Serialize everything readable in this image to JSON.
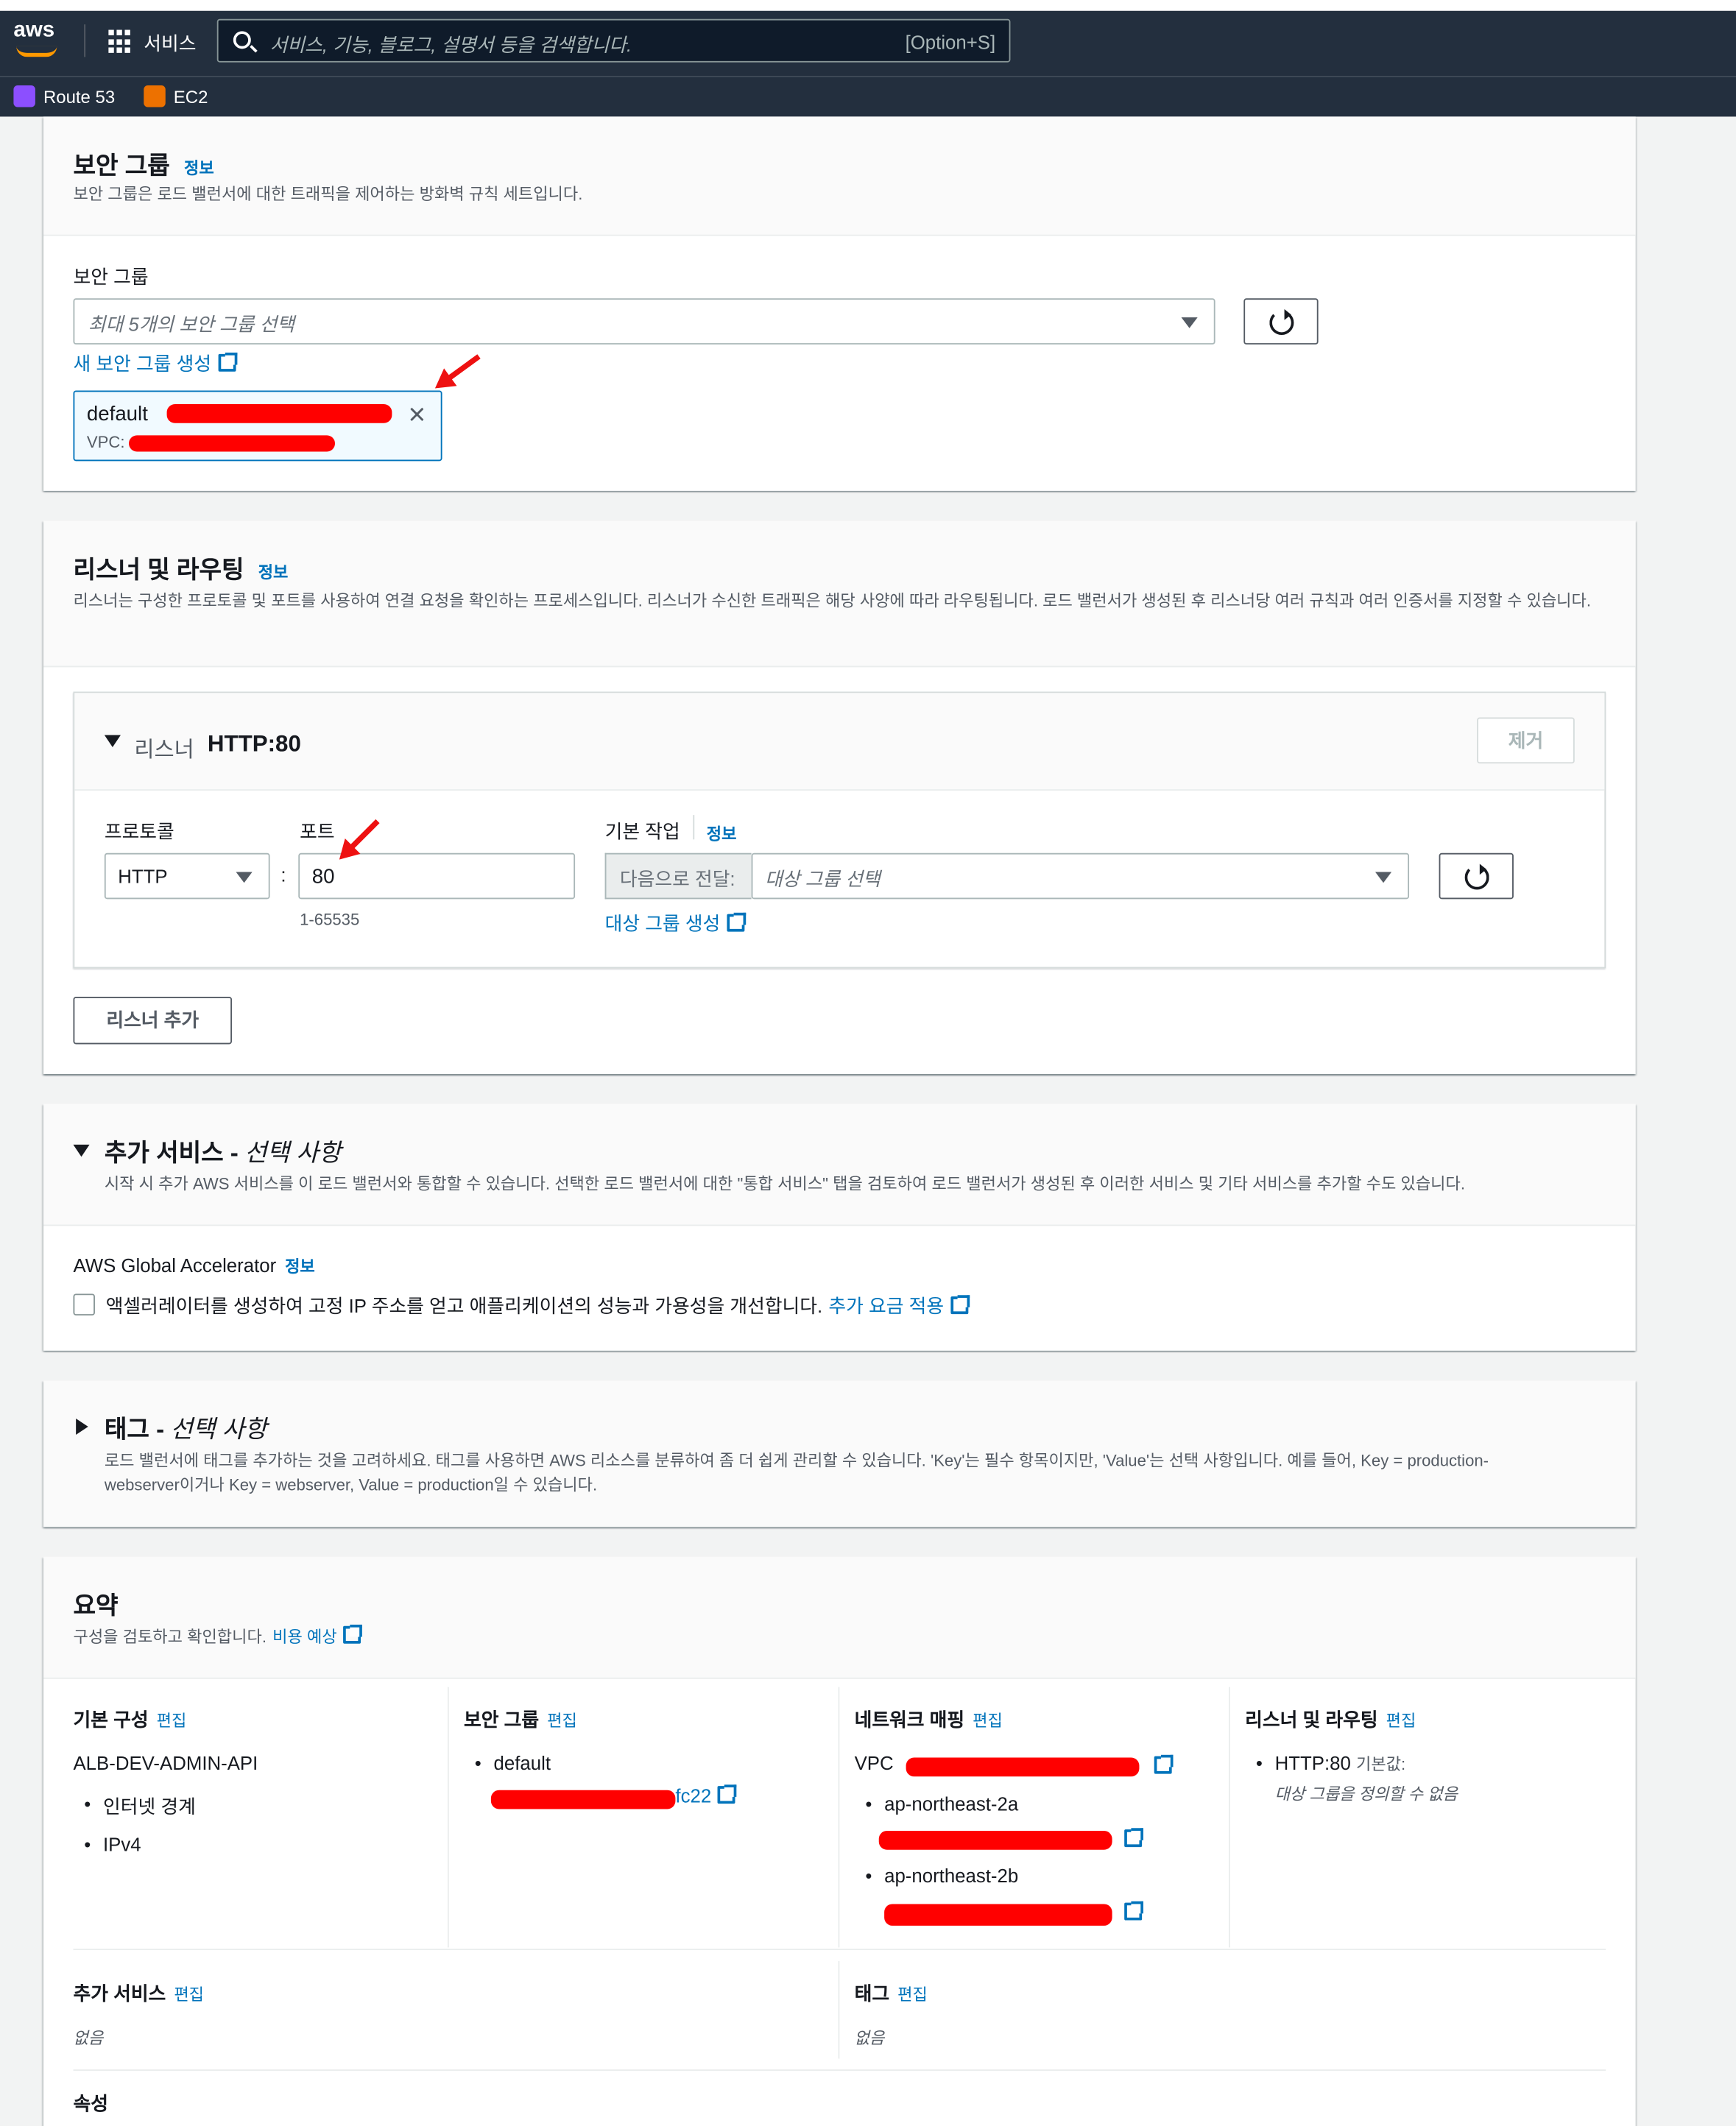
{
  "nav": {
    "logo": "aws",
    "services": "서비스",
    "search_placeholder": "서비스, 기능, 블로그, 설명서 등을 검색합니다.",
    "search_shortcut": "[Option+S]",
    "favorites": [
      {
        "label": "Route 53",
        "icon": "route53-icon",
        "color": "#8c4fff"
      },
      {
        "label": "EC2",
        "icon": "ec2-icon",
        "color": "#ed7100"
      }
    ]
  },
  "security_group": {
    "title": "보안 그룹",
    "info": "정보",
    "description": "보안 그룹은 로드 밸런서에 대한 트래픽을 제어하는 방화벽 규칙 세트입니다.",
    "field_label": "보안 그룹",
    "select_placeholder": "최대 5개의 보안 그룹 선택",
    "create_link": "새 보안 그룹 생성",
    "token_name": "default",
    "token_vpc_label": "VPC:"
  },
  "listeners": {
    "title": "리스너 및 라우팅",
    "info": "정보",
    "description": "리스너는 구성한 프로토콜 및 포트를 사용하여 연결 요청을 확인하는 프로세스입니다. 리스너가 수신한 트래픽은 해당 사양에 따라 라우팅됩니다. 로드 밸런서가 생성된 후 리스너당 여러 규칙과 여러 인증서를 지정할 수 있습니다.",
    "listener_prefix": "리스너",
    "listener_name": "HTTP:80",
    "remove_button": "제거",
    "protocol_label": "프로토콜",
    "protocol_value": "HTTP",
    "port_label": "포트",
    "port_value": "80",
    "port_hint": "1-65535",
    "port_separator": ":",
    "default_action_label": "기본 작업",
    "default_action_info": "정보",
    "forward_to": "다음으로 전달:",
    "target_group_placeholder": "대상 그룹 선택",
    "create_target_group": "대상 그룹 생성",
    "add_listener_button": "리스너 추가"
  },
  "addon_services": {
    "title": "추가 서비스 -",
    "optional": "선택 사항",
    "description": "시작 시 추가 AWS 서비스를 이 로드 밸런서와 통합할 수 있습니다. 선택한 로드 밸런서에 대한 \"통합 서비스\" 탭을 검토하여 로드 밸런서가 생성된 후 이러한 서비스 및 기타 서비스를 추가할 수도 있습니다.",
    "ga_label": "AWS Global Accelerator",
    "ga_info": "정보",
    "ga_checkbox_text": "액셀러레이터를 생성하여 고정 IP 주소를 얻고 애플리케이션의 성능과 가용성을 개선합니다.",
    "ga_link": "추가 요금 적용"
  },
  "tags": {
    "title": "태그 -",
    "optional": "선택 사항",
    "description": "로드 밸런서에 태그를 추가하는 것을 고려하세요. 태그를 사용하면 AWS 리소스를 분류하여 좀 더 쉽게 관리할 수 있습니다. 'Key'는 필수 항목이지만, 'Value'는 선택 사항입니다. 예를 들어, Key = production-webserver이거나 Key = webserver, Value = production일 수 있습니다."
  },
  "summary": {
    "title": "요약",
    "description": "구성을 검토하고 확인합니다.",
    "cost_link": "비용 예상",
    "edit": "편집",
    "basic": {
      "title": "기본 구성",
      "name": "ALB-DEV-ADMIN-API",
      "items": [
        "인터넷 경계",
        "IPv4"
      ]
    },
    "sg": {
      "title": "보안 그룹",
      "item": "default",
      "id_suffix": "fc22"
    },
    "network": {
      "title": "네트워크 매핑",
      "vpc_label": "VPC",
      "azs": [
        "ap-northeast-2a",
        "ap-northeast-2b"
      ]
    },
    "listeners": {
      "title": "리스너 및 라우팅",
      "item": "HTTP:80",
      "default_label": "기본값:",
      "undefined": "대상 그룹을 정의할 수 없음"
    },
    "addons": {
      "title": "추가 서비스",
      "value": "없음"
    },
    "tags": {
      "title": "태그",
      "value": "없음"
    },
    "attributes": {
      "title": "속성"
    }
  }
}
